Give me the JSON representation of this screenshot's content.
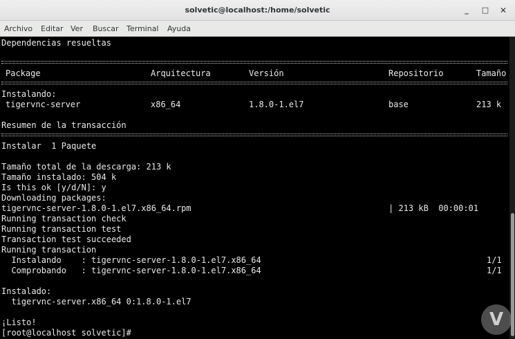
{
  "window": {
    "title": "solvetic@localhost:/home/solvetic",
    "minimize_glyph": "_",
    "maximize_glyph": "□",
    "close_glyph": "✕"
  },
  "menubar": {
    "items": [
      "Archivo",
      "Editar",
      "Ver",
      "Buscar",
      "Terminal",
      "Ayuda"
    ]
  },
  "terminal": {
    "deps_resolved": "Dependencias resueltas",
    "table": {
      "headers": [
        "Package",
        "Arquitectura",
        "Versión",
        "Repositorio",
        "Tamaño"
      ],
      "section_label": "Instalando:",
      "row": [
        "tigervnc-server",
        "x86_64",
        "1.8.0-1.el7",
        "base",
        "213 k"
      ]
    },
    "summary_title": "Resumen de la transacción",
    "install_line": "Instalar  1 Paquete",
    "lines_block": [
      "Tamaño total de la descarga: 213 k",
      "Tamaño instalado: 504 k",
      "Is this ok [y/d/N]: y",
      "Downloading packages:"
    ],
    "download": {
      "file": "tigervnc-server-1.8.0-1.el7.x86_64.rpm",
      "progress": "| 213 kB  00:00:01"
    },
    "run_lines": [
      "Running transaction check",
      "Running transaction test",
      "Transaction test succeeded",
      "Running transaction"
    ],
    "steps": [
      {
        "label": "  Instalando    : tigervnc-server-1.8.0-1.el7.x86_64",
        "count": "1/1"
      },
      {
        "label": "  Comprobando   : tigervnc-server-1.8.0-1.el7.x86_64",
        "count": "1/1"
      }
    ],
    "installed_label": "Instalado:",
    "installed_pkg": "  tigervnc-server.x86_64 0:1.8.0-1.el7",
    "done": "¡Listo!",
    "prompt": "[root@localhost solvetic]#"
  },
  "watermark": {
    "glyph": "V"
  }
}
